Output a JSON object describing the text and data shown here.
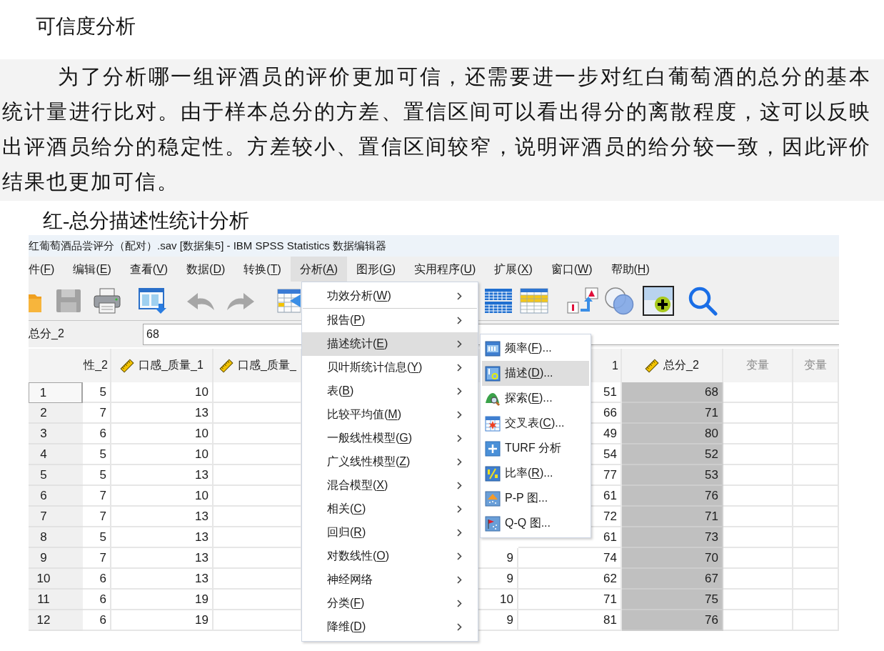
{
  "document": {
    "heading": "可信度分析",
    "paragraph": "为了分析哪一组评酒员的评价更加可信，还需要进一步对红白葡萄酒的总分的基本统计量进行比对。由于样本总分的方差、置信区间可以看出得分的离散程度，这可以反映出评酒员给分的稳定性。方差较小、置信区间较窄，说明评酒员的给分较一致，因此评价结果也更加可信。",
    "subheading": "红-总分描述性统计分析"
  },
  "window": {
    "title": "红葡萄酒品尝评分（配对）.sav [数据集5] - IBM SPSS Statistics 数据编辑器"
  },
  "menu_bar": [
    {
      "label": "件(F)",
      "selected": false
    },
    {
      "label": "编辑(E)",
      "selected": false
    },
    {
      "label": "查看(V)",
      "selected": false
    },
    {
      "label": "数据(D)",
      "selected": false
    },
    {
      "label": "转换(T)",
      "selected": false
    },
    {
      "label": "分析(A)",
      "selected": true
    },
    {
      "label": "图形(G)",
      "selected": false
    },
    {
      "label": "实用程序(U)",
      "selected": false
    },
    {
      "label": "扩展(X)",
      "selected": false
    },
    {
      "label": "窗口(W)",
      "selected": false
    },
    {
      "label": "帮助(H)",
      "selected": false
    }
  ],
  "toolbar": {
    "groups": [
      [
        {
          "disabled": false
        },
        {
          "disabled": true
        },
        {
          "disabled": false
        },
        {
          "disabled": false
        },
        {
          "disabled": true
        },
        {
          "disabled": true
        },
        {
          "disabled": false
        }
      ],
      [
        {
          "disabled": false
        },
        {
          "disabled": false
        },
        {
          "disabled": false
        },
        {
          "disabled": false
        },
        {
          "disabled": false
        },
        {
          "disabled": false
        }
      ]
    ]
  },
  "cell_editor": {
    "reference": "总分_2",
    "value": "68"
  },
  "table": {
    "columns": [
      {
        "header": "性_2",
        "kind": "cut_start",
        "selected": false,
        "values": [
          "5",
          "7",
          "6",
          "5",
          "5",
          "7",
          "7",
          "5",
          "7",
          "6",
          "6",
          "6"
        ]
      },
      {
        "header": "口感_质量_1",
        "kind": "scale",
        "selected": false,
        "values": [
          "10",
          "13",
          "10",
          "10",
          "13",
          "10",
          "13",
          "13",
          "13",
          "13",
          "19",
          "19"
        ]
      },
      {
        "header": "口感_质量_",
        "kind": "cut_end",
        "selected": false
      },
      {
        "kind": "hidden",
        "selected": false,
        "tail_values": [
          "9",
          "9",
          "10",
          "9"
        ]
      },
      {
        "header": "1",
        "kind": "cut_start",
        "selected": false,
        "values": [
          "51",
          "66",
          "49",
          "54",
          "77",
          "61",
          "72",
          "61",
          "74",
          "62",
          "71",
          "81"
        ]
      },
      {
        "header": "总分_2",
        "kind": "scale",
        "selected": true,
        "values": [
          "68",
          "71",
          "80",
          "52",
          "53",
          "76",
          "71",
          "73",
          "70",
          "67",
          "75",
          "76"
        ]
      },
      {
        "header": "变量",
        "kind": "empty",
        "selected": false
      },
      {
        "header": "变量",
        "kind": "empty",
        "selected": false
      }
    ],
    "rows": [
      {
        "label": "1",
        "selected": true
      },
      {
        "label": "2",
        "selected": false
      },
      {
        "label": "3",
        "selected": false
      },
      {
        "label": "4",
        "selected": false
      },
      {
        "label": "5",
        "selected": false
      },
      {
        "label": "6",
        "selected": false
      },
      {
        "label": "7",
        "selected": false
      },
      {
        "label": "8",
        "selected": false
      },
      {
        "label": "9",
        "selected": false
      },
      {
        "label": "10",
        "selected": false
      },
      {
        "label": "11",
        "selected": false
      },
      {
        "label": "12",
        "selected": false
      }
    ]
  },
  "analyze_menu": {
    "groups": [
      [
        {
          "label": "功效分析(W)",
          "selected": false
        }
      ],
      [
        {
          "label": "报告(P)",
          "selected": false
        },
        {
          "label": "描述统计(E)",
          "selected": true
        },
        {
          "label": "贝叶斯统计信息(Y)",
          "selected": false
        },
        {
          "label": "表(B)",
          "selected": false
        },
        {
          "label": "比较平均值(M)",
          "selected": false
        },
        {
          "label": "一般线性模型(G)",
          "selected": false
        },
        {
          "label": "广义线性模型(Z)",
          "selected": false
        },
        {
          "label": "混合模型(X)",
          "selected": false
        },
        {
          "label": "相关(C)",
          "selected": false
        },
        {
          "label": "回归(R)",
          "selected": false
        },
        {
          "label": "对数线性(O)",
          "selected": false
        },
        {
          "label": "神经网络",
          "selected": false
        },
        {
          "label": "分类(F)",
          "selected": false
        },
        {
          "label": "降维(D)",
          "selected": false
        }
      ]
    ]
  },
  "submenu": {
    "items": [
      {
        "label": "频率(F)...",
        "selected": false
      },
      {
        "label": "描述(D)...",
        "selected": true
      },
      {
        "label": "探索(E)...",
        "selected": false
      },
      {
        "label": "交叉表(C)...",
        "selected": false
      },
      {
        "label": "TURF 分析",
        "selected": false
      },
      {
        "label": "比率(R)...",
        "selected": false
      },
      {
        "label": "P-P 图...",
        "selected": false
      },
      {
        "label": "Q-Q 图...",
        "selected": false
      }
    ]
  }
}
